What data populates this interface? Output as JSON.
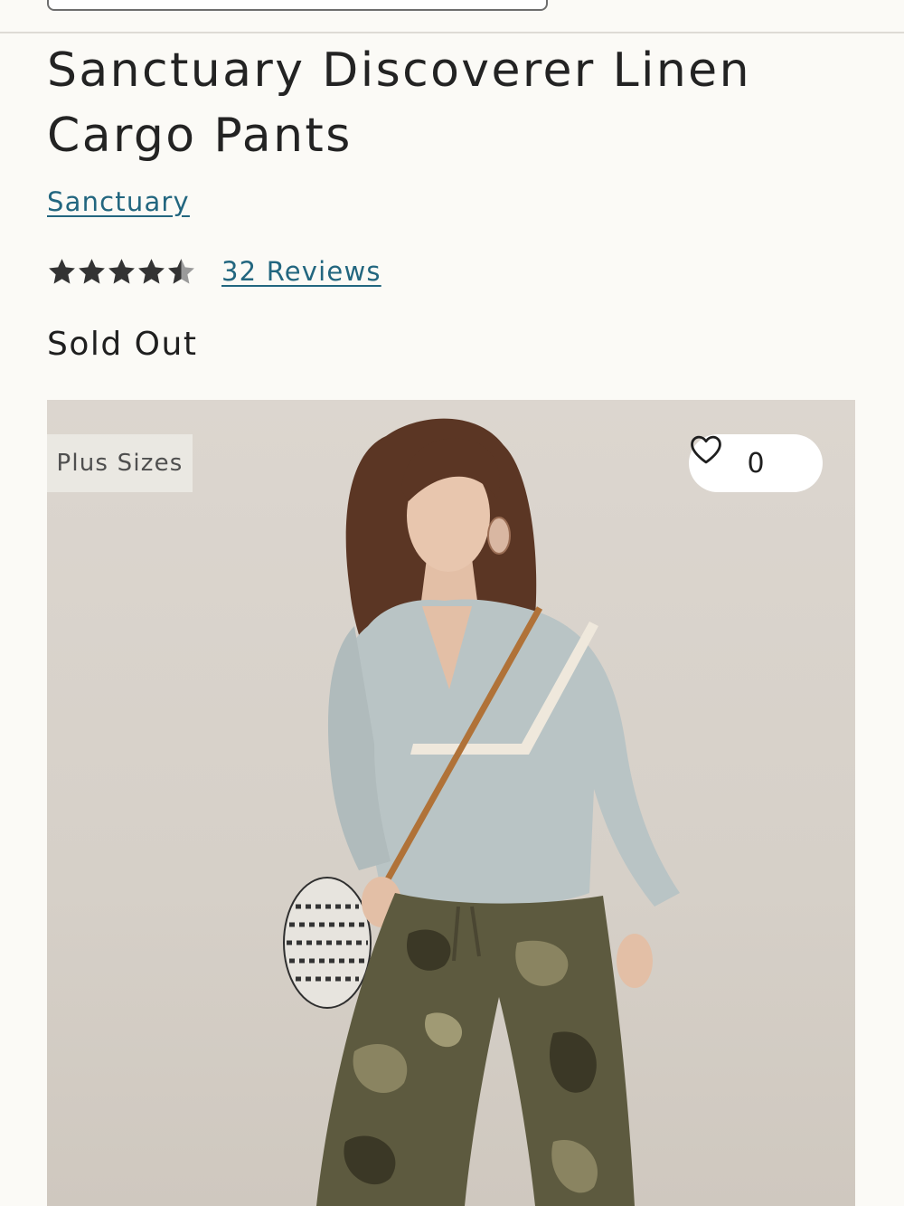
{
  "product": {
    "title": "Sanctuary Discoverer Linen Cargo Pants",
    "brand": "Sanctuary",
    "rating": 4.5,
    "rating_max": 5,
    "reviews_label": "32 Reviews",
    "status": "Sold Out"
  },
  "image": {
    "badge": "Plus Sizes",
    "wishlist_count": "0",
    "alt": "Model wearing a light blue blouse and camouflage cargo pants"
  },
  "icons": {
    "star": "star-icon",
    "heart": "heart-icon"
  },
  "colors": {
    "link": "#22667f",
    "text": "#232323",
    "background": "#fbfaf6",
    "star": "#333333"
  }
}
